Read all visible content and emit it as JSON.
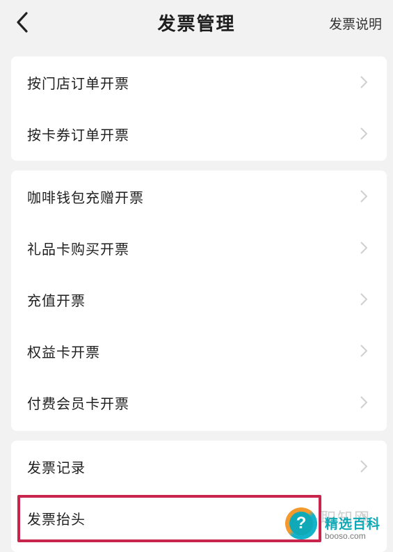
{
  "header": {
    "title": "发票管理",
    "help_link": "发票说明",
    "back_icon": "chevron-left-icon"
  },
  "groups": [
    {
      "items": [
        {
          "label": "按门店订单开票"
        },
        {
          "label": "按卡券订单开票"
        }
      ]
    },
    {
      "items": [
        {
          "label": "咖啡钱包充赠开票"
        },
        {
          "label": "礼品卡购买开票"
        },
        {
          "label": "充值开票"
        },
        {
          "label": "权益卡开票"
        },
        {
          "label": "付费会员卡开票"
        }
      ]
    },
    {
      "items": [
        {
          "label": "发票记录"
        },
        {
          "label": "发票抬头"
        }
      ]
    }
  ],
  "highlight_color": "#c9244b",
  "watermark": {
    "faint_text": "职知网",
    "brand": "精选百科",
    "url": "booso.com",
    "icon": "question-mark-icon"
  }
}
